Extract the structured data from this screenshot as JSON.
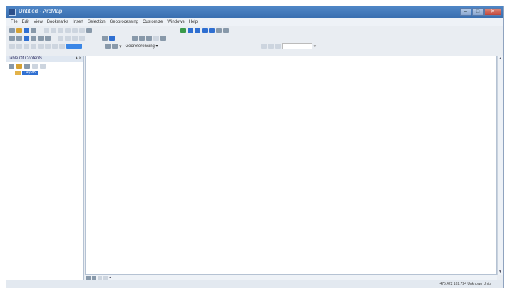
{
  "window": {
    "title": "Untitled - ArcMap",
    "minimize": "–",
    "maximize": "□",
    "close": "✕"
  },
  "menu": [
    "File",
    "Edit",
    "View",
    "Bookmarks",
    "Insert",
    "Selection",
    "Geoprocessing",
    "Customize",
    "Windows",
    "Help"
  ],
  "toolbar": {
    "georeferencing_label": "Georeferencing ▾"
  },
  "toc": {
    "title": "Table Of Contents",
    "pin": "♦ ×",
    "layer_label": "Layers"
  },
  "status": {
    "coords": "475.422  182.724 Unknown Units"
  }
}
